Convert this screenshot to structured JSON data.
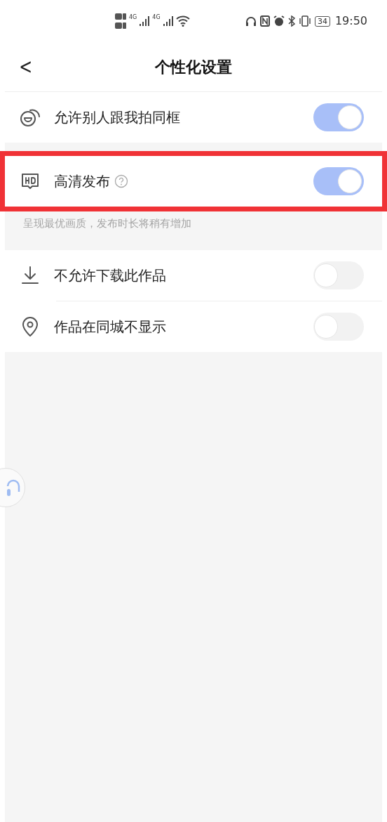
{
  "status_bar": {
    "network_1": "4G",
    "network_2": "4G",
    "battery": "34",
    "time": "19:50"
  },
  "header": {
    "back": "<",
    "title": "个性化设置"
  },
  "settings": [
    {
      "kind": "duet",
      "label": "允许别人跟我拍同框",
      "on": true,
      "gap_after": true
    },
    {
      "kind": "hd",
      "label": "高清发布",
      "on": true,
      "highlighted": true,
      "help": true,
      "note": "呈现最优画质，发布时长将稍有增加"
    },
    {
      "kind": "download",
      "label": "不允许下载此作品",
      "on": false
    },
    {
      "kind": "location",
      "label": "作品在同城不显示",
      "on": false
    }
  ]
}
